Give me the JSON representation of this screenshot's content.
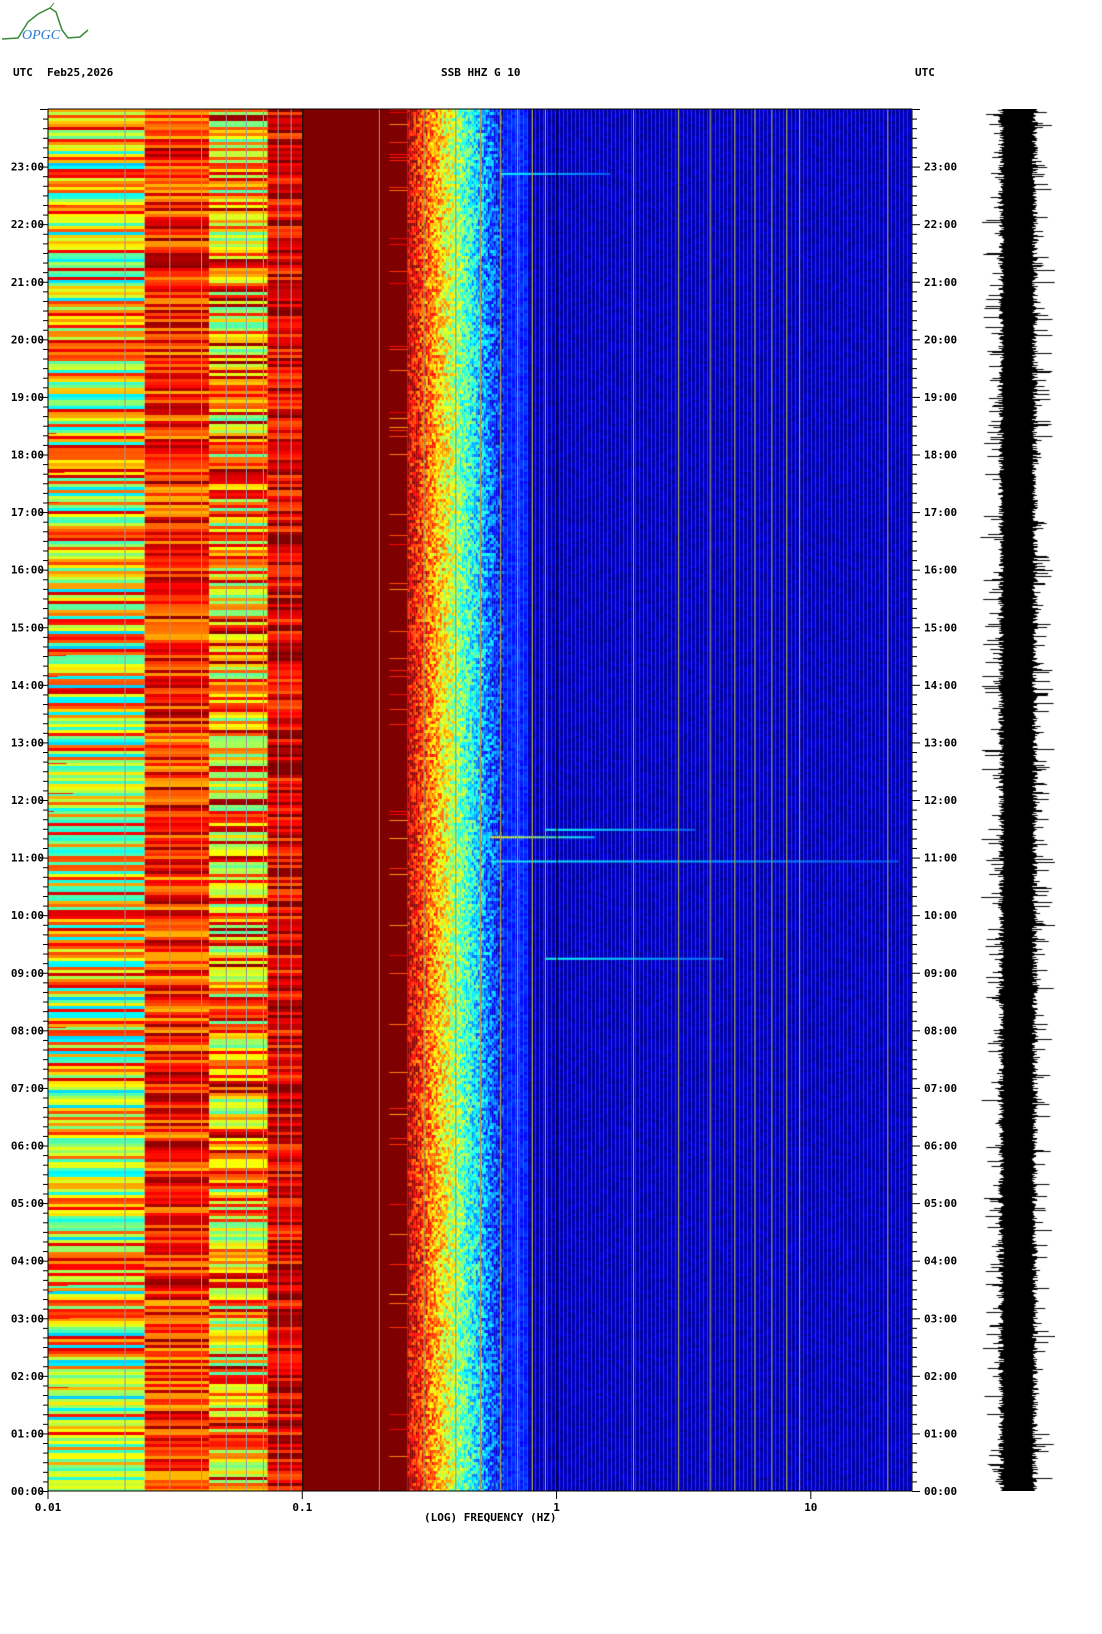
{
  "header": {
    "timezone_left": "UTC",
    "date": "Feb25,2026",
    "station": "SSB HHZ G 10",
    "timezone_right": "UTC"
  },
  "logo": {
    "text": "OPGC"
  },
  "chart_data": {
    "type": "heatmap",
    "title": "SSB HHZ G 10",
    "xlabel": "(LOG) FREQUENCY (HZ)",
    "ylabel": "UTC",
    "x_scale": "log",
    "xlim": [
      0.01,
      25
    ],
    "x_ticks": [
      {
        "value": 0.01,
        "label": "0.01"
      },
      {
        "value": 0.1,
        "label": "0.1"
      },
      {
        "value": 1,
        "label": "1"
      },
      {
        "value": 10,
        "label": "10"
      }
    ],
    "x_gridlines": [
      0.02,
      0.03,
      0.04,
      0.05,
      0.06,
      0.07,
      0.08,
      0.09,
      0.1,
      0.2,
      0.3,
      0.4,
      0.5,
      0.6,
      0.7,
      0.8,
      0.9,
      1,
      2,
      3,
      4,
      5,
      6,
      7,
      8,
      9,
      20
    ],
    "ylim_hours": [
      0,
      24
    ],
    "y_ticks": [
      "00:00",
      "01:00",
      "02:00",
      "03:00",
      "04:00",
      "05:00",
      "06:00",
      "07:00",
      "08:00",
      "09:00",
      "10:00",
      "11:00",
      "12:00",
      "13:00",
      "14:00",
      "15:00",
      "16:00",
      "17:00",
      "18:00",
      "19:00",
      "20:00",
      "21:00",
      "22:00",
      "23:00"
    ],
    "colormap": "jet",
    "power_level_by_band": [
      {
        "f_min": 0.01,
        "f_max": 0.024,
        "mean_level": 0.62,
        "spread": 0.2
      },
      {
        "f_min": 0.024,
        "f_max": 0.043,
        "mean_level": 0.84,
        "spread": 0.1
      },
      {
        "f_min": 0.043,
        "f_max": 0.073,
        "mean_level": 0.72,
        "spread": 0.18
      },
      {
        "f_min": 0.073,
        "f_max": 0.1,
        "mean_level": 0.9,
        "spread": 0.08
      },
      {
        "f_min": 0.1,
        "f_max": 0.26,
        "mean_level": 1.0,
        "spread": 0.0
      },
      {
        "f_min": 0.26,
        "f_max": 0.62,
        "mean_level": 0.55,
        "spread": 0.15
      },
      {
        "f_min": 0.62,
        "f_max": 25,
        "mean_level": 0.06,
        "spread": 0.03
      }
    ],
    "events": [
      {
        "time": "22:53",
        "hours": 22.89,
        "f_min": 0.6,
        "f_max": 1.6,
        "level": 0.3
      },
      {
        "time": "11:22",
        "hours": 11.37,
        "f_min": 0.55,
        "f_max": 1.4,
        "level": 0.55
      },
      {
        "time": "11:30",
        "hours": 11.5,
        "f_min": 0.9,
        "f_max": 3.5,
        "level": 0.3
      },
      {
        "time": "10:57",
        "hours": 10.95,
        "f_min": 0.55,
        "f_max": 22,
        "level": 0.3
      },
      {
        "time": "09:16",
        "hours": 9.26,
        "f_min": 0.9,
        "f_max": 4.5,
        "level": 0.3
      }
    ]
  }
}
